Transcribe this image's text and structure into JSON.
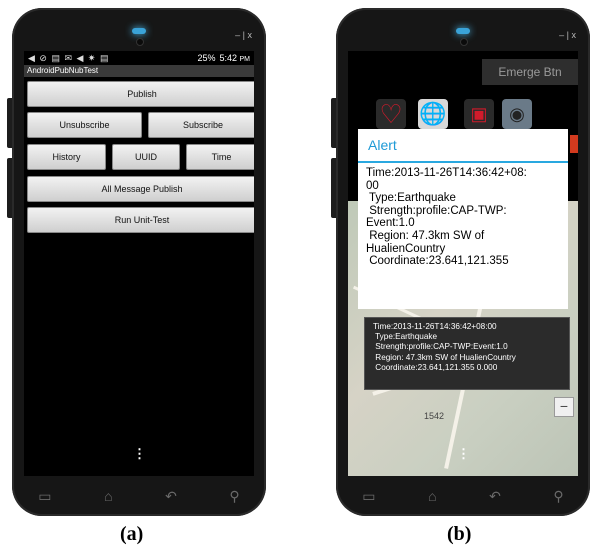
{
  "figure_a": {
    "status": {
      "icons": "◀ ⊘ ▤ ✉ ◀ ✷ ▤",
      "battery": "25%",
      "time": "5:42",
      "time_suffix": "PM"
    },
    "app_title": "AndroidPubNubTest",
    "buttons": {
      "publish": "Publish",
      "unsubscribe": "Unsubscribe",
      "subscribe": "Subscribe",
      "history": "History",
      "uuid": "UUID",
      "time": "Time",
      "all_message_publish": "All Message Publish",
      "run_unit_test": "Run Unit-Test"
    },
    "caption": "(a)"
  },
  "figure_b": {
    "emerge_button": "Emerge Btn",
    "alert": {
      "title": "Alert",
      "lines": [
        "Time:2013-11-26T14:36:42+08:",
        "00",
        " Type:Earthquake",
        " Strength:profile:CAP-TWP:",
        "Event:1.0",
        " Region: 47.3km SW of",
        "HualienCountry",
        " Coordinate:23.641,121.355"
      ]
    },
    "toast": {
      "lines": [
        "Time:2013-11-26T14:36:42+08:00",
        " Type:Earthquake",
        " Strength:profile:CAP-TWP:Event:1.0",
        " Region: 47.3km SW of HualienCountry",
        " Coordinate:23.641,121.355 0.000"
      ]
    },
    "map_label": "1542",
    "caption": "(b)"
  },
  "window_controls": "– | x"
}
